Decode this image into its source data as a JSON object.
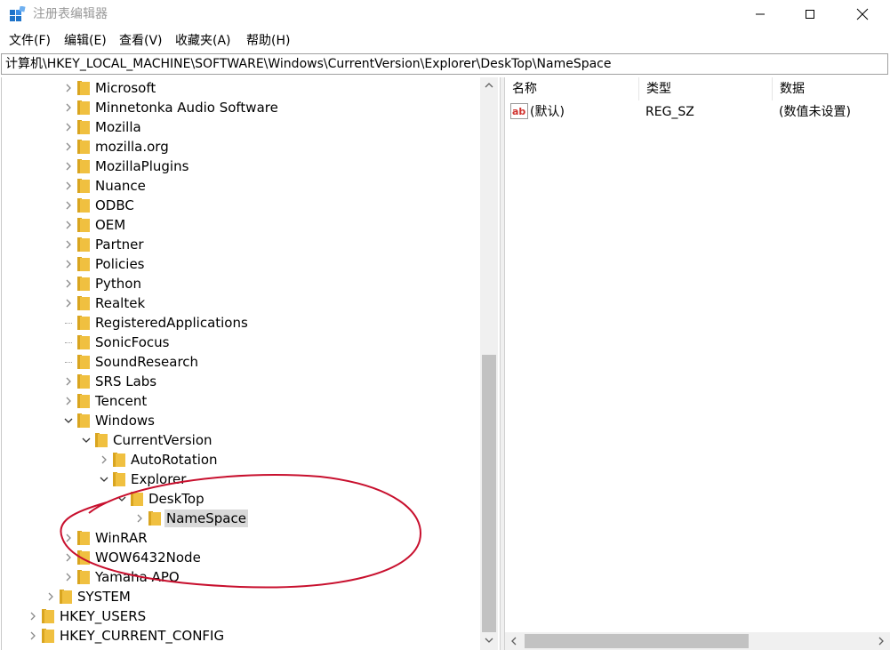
{
  "window": {
    "title": "注册表编辑器",
    "minimize_glyph": "—",
    "maximize_glyph": "☐",
    "close_glyph": "✕",
    "app_icon": "registry-editor-icon"
  },
  "menu": [
    "文件(F)",
    "编辑(E)",
    "查看(V)",
    "收藏夹(A)",
    "帮助(H)"
  ],
  "address": "计算机\\HKEY_LOCAL_MACHINE\\SOFTWARE\\Windows\\CurrentVersion\\Explorer\\DeskTop\\NameSpace",
  "tree": [
    {
      "label": "Microsoft",
      "level": 2,
      "expander": "collapsed"
    },
    {
      "label": "Minnetonka Audio Software",
      "level": 2,
      "expander": "collapsed"
    },
    {
      "label": "Mozilla",
      "level": 2,
      "expander": "collapsed"
    },
    {
      "label": "mozilla.org",
      "level": 2,
      "expander": "collapsed"
    },
    {
      "label": "MozillaPlugins",
      "level": 2,
      "expander": "collapsed"
    },
    {
      "label": "Nuance",
      "level": 2,
      "expander": "collapsed"
    },
    {
      "label": "ODBC",
      "level": 2,
      "expander": "collapsed"
    },
    {
      "label": "OEM",
      "level": 2,
      "expander": "collapsed"
    },
    {
      "label": "Partner",
      "level": 2,
      "expander": "collapsed"
    },
    {
      "label": "Policies",
      "level": 2,
      "expander": "collapsed"
    },
    {
      "label": "Python",
      "level": 2,
      "expander": "collapsed"
    },
    {
      "label": "Realtek",
      "level": 2,
      "expander": "collapsed"
    },
    {
      "label": "RegisteredApplications",
      "level": 2,
      "expander": "none"
    },
    {
      "label": "SonicFocus",
      "level": 2,
      "expander": "none"
    },
    {
      "label": "SoundResearch",
      "level": 2,
      "expander": "none"
    },
    {
      "label": "SRS Labs",
      "level": 2,
      "expander": "collapsed"
    },
    {
      "label": "Tencent",
      "level": 2,
      "expander": "collapsed"
    },
    {
      "label": "Windows",
      "level": 2,
      "expander": "expanded"
    },
    {
      "label": "CurrentVersion",
      "level": 3,
      "expander": "expanded"
    },
    {
      "label": "AutoRotation",
      "level": 4,
      "expander": "collapsed"
    },
    {
      "label": "Explorer",
      "level": 4,
      "expander": "expanded"
    },
    {
      "label": "DeskTop",
      "level": 5,
      "expander": "expanded"
    },
    {
      "label": "NameSpace",
      "level": 6,
      "expander": "collapsed",
      "selected": true
    },
    {
      "label": "WinRAR",
      "level": 2,
      "expander": "collapsed"
    },
    {
      "label": "WOW6432Node",
      "level": 2,
      "expander": "collapsed"
    },
    {
      "label": "Yamaha APO",
      "level": 2,
      "expander": "collapsed"
    },
    {
      "label": "SYSTEM",
      "level": 1,
      "expander": "collapsed"
    },
    {
      "label": "HKEY_USERS",
      "level": 0,
      "expander": "collapsed"
    },
    {
      "label": "HKEY_CURRENT_CONFIG",
      "level": 0,
      "expander": "collapsed"
    }
  ],
  "list": {
    "columns": [
      "名称",
      "类型",
      "数据"
    ],
    "rows": [
      {
        "name": "(默认)",
        "type": "REG_SZ",
        "data": "(数值未设置)",
        "icon": "string-value-icon"
      }
    ]
  },
  "colors": {
    "folder": "#f0c040",
    "folder_dark": "#d9a520",
    "annotation": "#c8102e",
    "selection": "#d9d9d9"
  }
}
